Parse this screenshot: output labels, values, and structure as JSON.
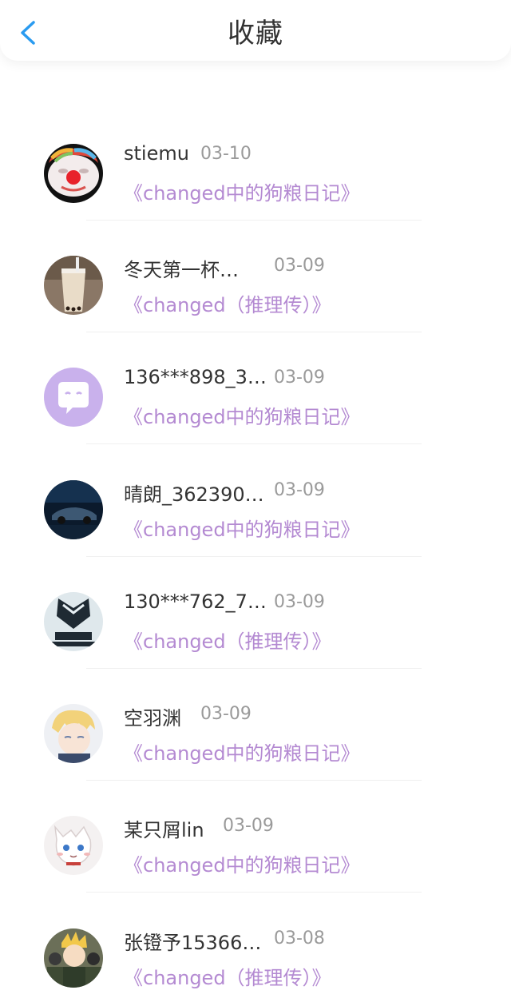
{
  "header": {
    "title": "收藏",
    "back_icon": "chevron-left-icon",
    "accent": "#2a9bf0"
  },
  "colors": {
    "work_link": "#b48ad2",
    "name_text": "#333333",
    "date_text": "#9a9a9a"
  },
  "items": [
    {
      "name": "stiemu",
      "date": "03-10",
      "work": "《changed中的狗粮日记》"
    },
    {
      "name": "冬天第一杯…",
      "date": "03-09",
      "work": "《changed（推理传）》"
    },
    {
      "name": "136***898_3…",
      "date": "03-09",
      "work": "《changed中的狗粮日记》"
    },
    {
      "name": "晴朗_362390…",
      "date": "03-09",
      "work": "《changed中的狗粮日记》"
    },
    {
      "name": "130***762_7…",
      "date": "03-09",
      "work": "《changed（推理传）》"
    },
    {
      "name": "空羽渊",
      "date": "03-09",
      "work": "《changed中的狗粮日记》"
    },
    {
      "name": "某只屑lin",
      "date": "03-09",
      "work": "《changed中的狗粮日记》"
    },
    {
      "name": "张镫予15366…",
      "date": "03-08",
      "work": "《changed（推理传）》"
    }
  ]
}
